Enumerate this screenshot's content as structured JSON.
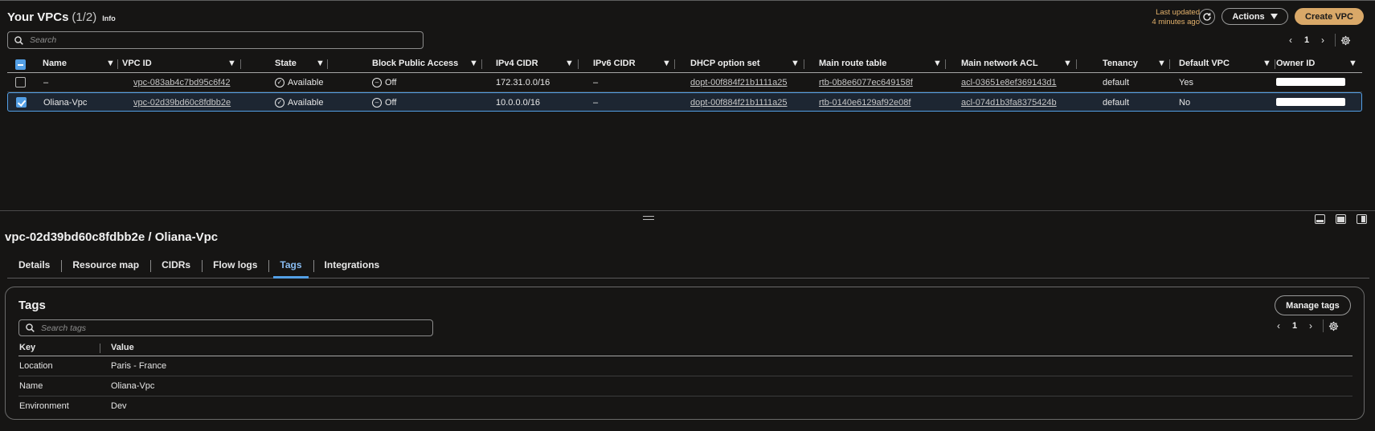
{
  "header": {
    "title": "Your VPCs",
    "count": "(1/2)",
    "info": "Info",
    "last_updated_line1": "Last updated",
    "last_updated_line2": "4 minutes ago",
    "actions_label": "Actions",
    "create_label": "Create VPC",
    "search_placeholder": "Search",
    "page": "1"
  },
  "columns": [
    "Name",
    "VPC ID",
    "State",
    "Block Public Access",
    "IPv4 CIDR",
    "IPv6 CIDR",
    "DHCP option set",
    "Main route table",
    "Main network ACL",
    "Tenancy",
    "Default VPC",
    "Owner ID"
  ],
  "rows": [
    {
      "selected": false,
      "name": "–",
      "vpc_id": "vpc-083ab4c7bd95c6f42",
      "state": "Available",
      "block_public_access": "Off",
      "ipv4_cidr": "172.31.0.0/16",
      "ipv6_cidr": "–",
      "dhcp": "dopt-00f884f21b1111a25",
      "route_table": "rtb-0b8e6077ec649158f",
      "network_acl": "acl-03651e8ef369143d1",
      "tenancy": "default",
      "default_vpc": "Yes"
    },
    {
      "selected": true,
      "name": "Oliana-Vpc",
      "vpc_id": "vpc-02d39bd60c8fdbb2e",
      "state": "Available",
      "block_public_access": "Off",
      "ipv4_cidr": "10.0.0.0/16",
      "ipv6_cidr": "–",
      "dhcp": "dopt-00f884f21b1111a25",
      "route_table": "rtb-0140e6129af92e08f",
      "network_acl": "acl-074d1b3fa8375424b",
      "tenancy": "default",
      "default_vpc": "No"
    }
  ],
  "detail": {
    "title": "vpc-02d39bd60c8fdbb2e / Oliana-Vpc",
    "tabs": [
      "Details",
      "Resource map",
      "CIDRs",
      "Flow logs",
      "Tags",
      "Integrations"
    ],
    "active_tab": "Tags",
    "tags_title": "Tags",
    "manage_tags_label": "Manage tags",
    "search_tags_placeholder": "Search tags",
    "page": "1",
    "tag_columns": [
      "Key",
      "Value"
    ],
    "tags": [
      {
        "key": "Location",
        "value": "Paris - France"
      },
      {
        "key": "Name",
        "value": "Oliana-Vpc"
      },
      {
        "key": "Environment",
        "value": "Dev"
      }
    ]
  },
  "colors": {
    "accent_orange": "#d9a868",
    "selection_blue": "#539fe5",
    "background": "#161514"
  }
}
